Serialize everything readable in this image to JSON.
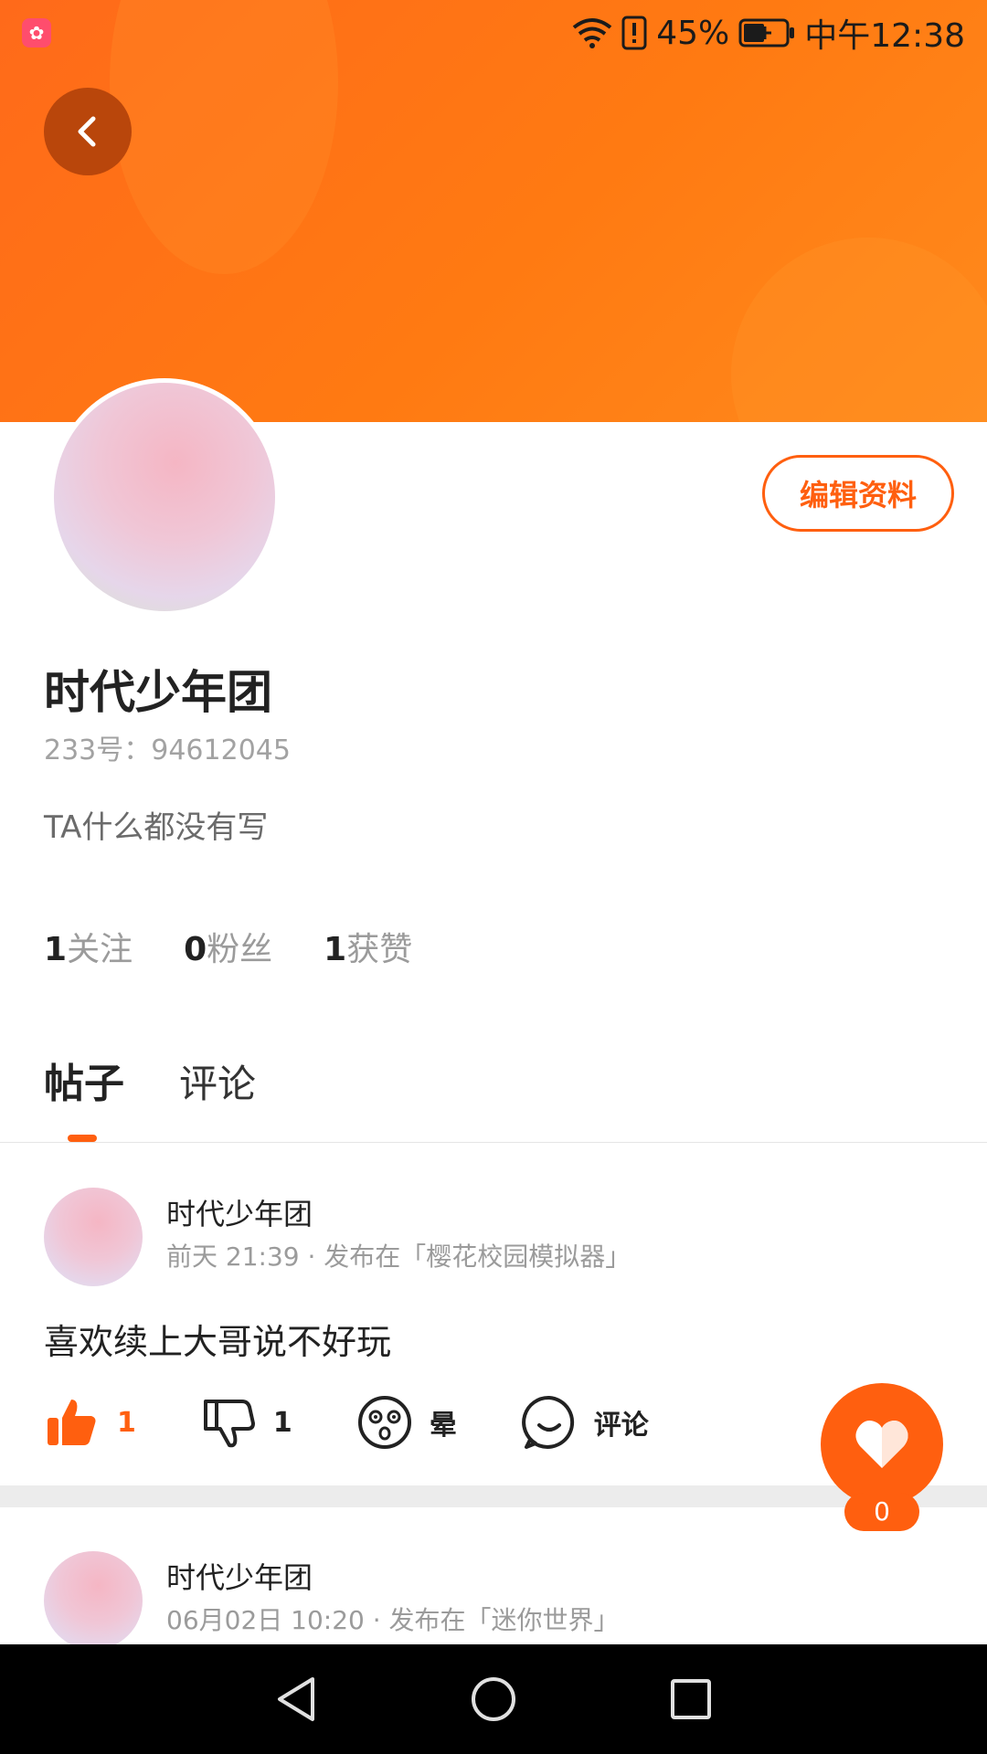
{
  "status_bar": {
    "battery_percent": "45%",
    "time": "中午12:38"
  },
  "profile": {
    "name": "时代少年团",
    "id_text": "233号：94612045",
    "bio": "TA什么都没有写",
    "edit_button": "编辑资料",
    "stats": [
      {
        "value": "1",
        "label": "关注"
      },
      {
        "value": "0",
        "label": "粉丝"
      },
      {
        "value": "1",
        "label": "获赞"
      }
    ]
  },
  "tabs": [
    {
      "label": "帖子",
      "active": true
    },
    {
      "label": "评论",
      "active": false
    }
  ],
  "posts": [
    {
      "author": "时代少年团",
      "meta": "前天 21:39 · 发布在「樱花校园模拟器」",
      "content": "喜欢续上大哥说不好玩",
      "actions": {
        "like": "1",
        "dislike": "1",
        "dizzy": "晕",
        "comment": "评论"
      }
    },
    {
      "author": "时代少年团",
      "meta": "06月02日 10:20 · 发布在「迷你世界」"
    }
  ],
  "fab": {
    "count": "0"
  },
  "colors": {
    "accent": "#ff5f0f",
    "banner": "#ff7a12"
  }
}
